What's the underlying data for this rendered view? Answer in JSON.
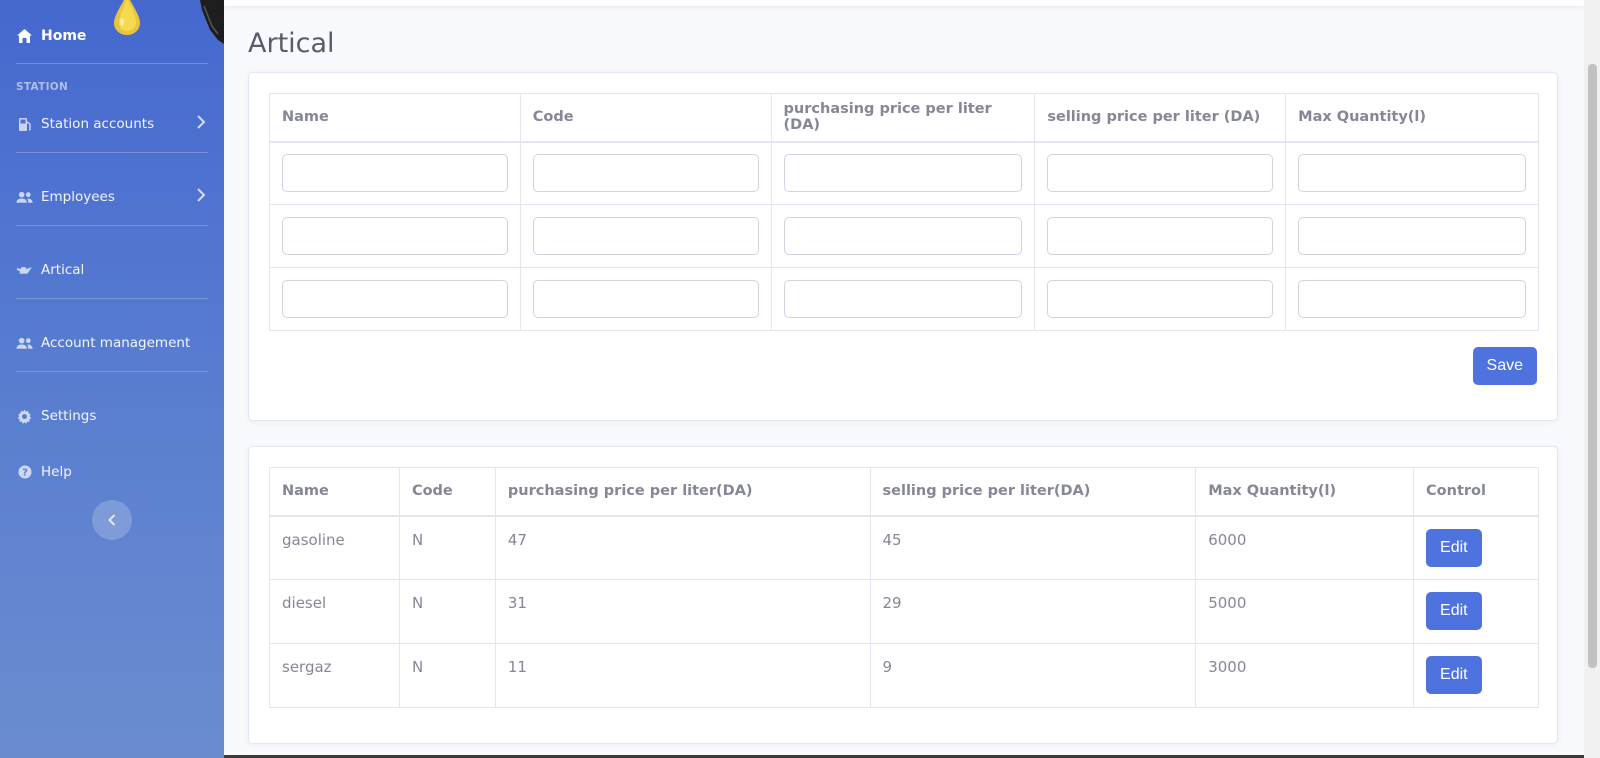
{
  "sidebar": {
    "home_label": "Home",
    "heading": "STATION",
    "items": [
      {
        "label": "Station accounts",
        "icon": "gas-pump-icon",
        "has_chevron": true
      },
      {
        "label": "Employees",
        "icon": "users-icon",
        "has_chevron": true
      },
      {
        "label": "Artical",
        "icon": "oil-can-icon",
        "has_chevron": false
      },
      {
        "label": "Account management",
        "icon": "users-icon",
        "has_chevron": false
      },
      {
        "label": "Settings",
        "icon": "gear-icon",
        "has_chevron": false
      },
      {
        "label": "Help",
        "icon": "question-circle-icon",
        "has_chevron": false
      }
    ],
    "toggle_icon": "chevron-left-icon"
  },
  "page": {
    "title": "Artical"
  },
  "form": {
    "headers": [
      "Name",
      "Code",
      "purchasing price per liter (DA)",
      "selling price per liter (DA)",
      "Max Quantity(l)"
    ],
    "rows": [
      [
        "",
        "",
        "",
        "",
        ""
      ],
      [
        "",
        "",
        "",
        "",
        ""
      ],
      [
        "",
        "",
        "",
        "",
        ""
      ]
    ],
    "save_label": "Save"
  },
  "list": {
    "headers": [
      "Name",
      "Code",
      "purchasing price per liter(DA)",
      "selling price per liter(DA)",
      "Max Quantity(l)",
      "Control"
    ],
    "rows": [
      {
        "name": "gasoline",
        "code": "N",
        "purchase": "47",
        "sell": "45",
        "max": "6000",
        "action": "Edit"
      },
      {
        "name": "diesel",
        "code": "N",
        "purchase": "31",
        "sell": "29",
        "max": "5000",
        "action": "Edit"
      },
      {
        "name": "sergaz",
        "code": "N",
        "purchase": "11",
        "sell": "9",
        "max": "3000",
        "action": "Edit"
      }
    ]
  },
  "colors": {
    "primary": "#4e73df",
    "sidebar_top": "#4568cf",
    "sidebar_bottom": "#6a8ccf",
    "text": "#858796",
    "title": "#5a5c69"
  }
}
